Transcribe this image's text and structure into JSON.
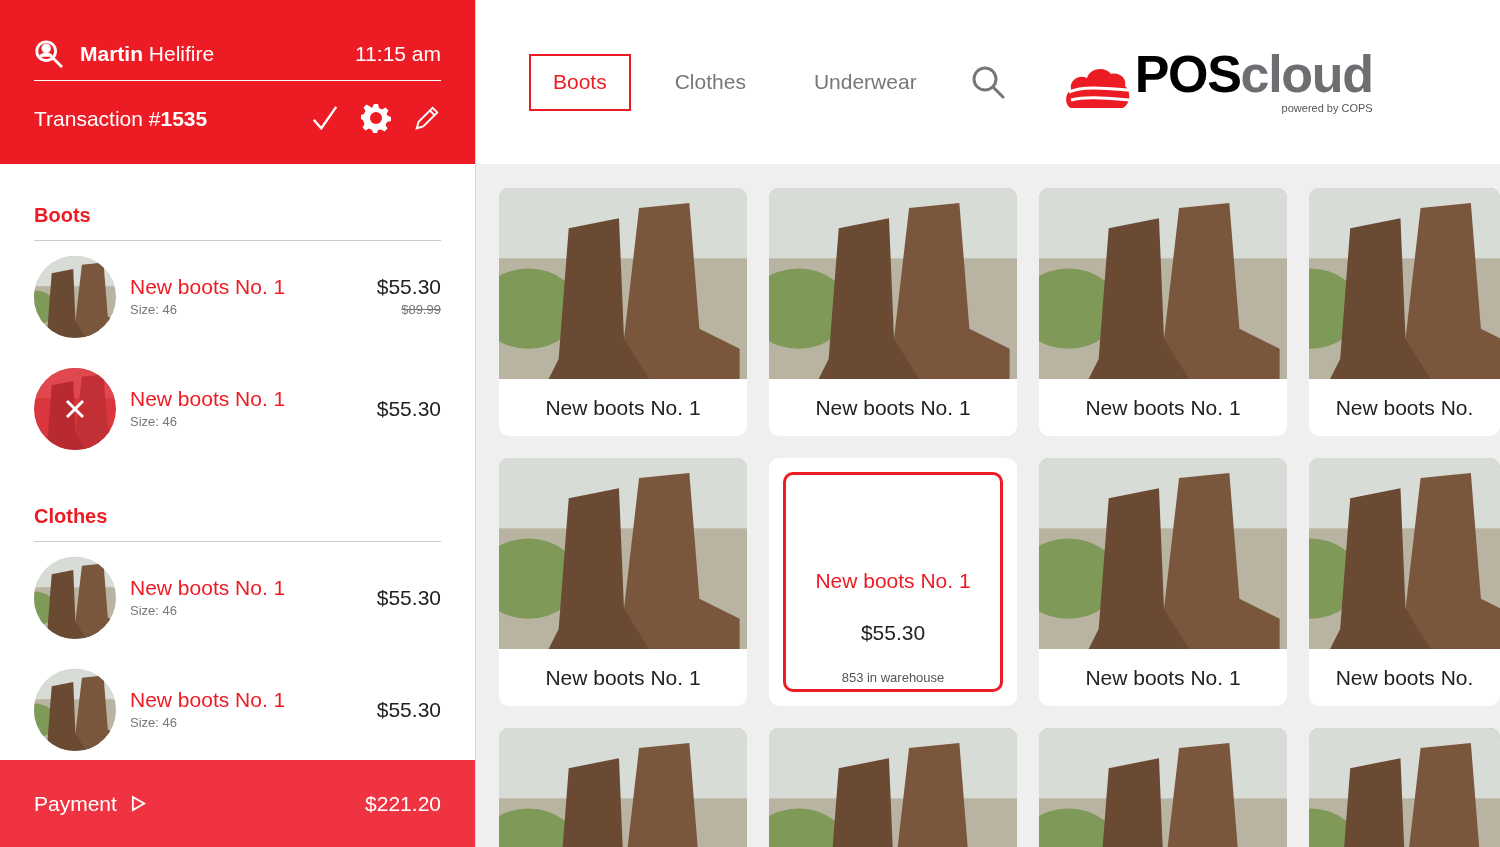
{
  "header": {
    "customer": "**Martin** Helifire",
    "time": "11:15 am",
    "transaction": "Transaction #**1535**"
  },
  "cart": [
    {
      "category": "Boots",
      "items": [
        {
          "name": "New boots No. 1",
          "size": "Size: 46",
          "price": "$55.30",
          "old_price": "$89.99",
          "removing": false
        },
        {
          "name": "New boots No. 1",
          "size": "Size: 46",
          "price": "$55.30",
          "removing": true
        }
      ]
    },
    {
      "category": "Clothes",
      "items": [
        {
          "name": "New boots No. 1",
          "size": "Size: 46",
          "price": "$55.30",
          "removing": false
        },
        {
          "name": "New boots No. 1",
          "size": "Size: 46",
          "price": "$55.30",
          "removing": false
        }
      ]
    }
  ],
  "payment": {
    "label": "Payment",
    "total": "$221.20"
  },
  "tabs": [
    {
      "label": "Boots",
      "selected": true
    },
    {
      "label": "Clothes",
      "selected": false
    },
    {
      "label": "Underwear",
      "selected": false
    }
  ],
  "logo": {
    "brand": "POS",
    "brand_2": "cloud",
    "tagline": "powered by COPS"
  },
  "products": [
    {
      "name": "New boots No. 1",
      "selected": false
    },
    {
      "name": "New boots No. 1",
      "selected": false
    },
    {
      "name": "New boots No. 1",
      "selected": false
    },
    {
      "name": "New boots No.",
      "selected": false
    },
    {
      "name": "New boots No. 1",
      "selected": false
    },
    {
      "name": "New boots No. 1",
      "price": "$55.30",
      "stock": "853 in warehouse",
      "selected": true
    },
    {
      "name": "New boots No. 1",
      "selected": false
    },
    {
      "name": "New boots No.",
      "selected": false
    }
  ]
}
